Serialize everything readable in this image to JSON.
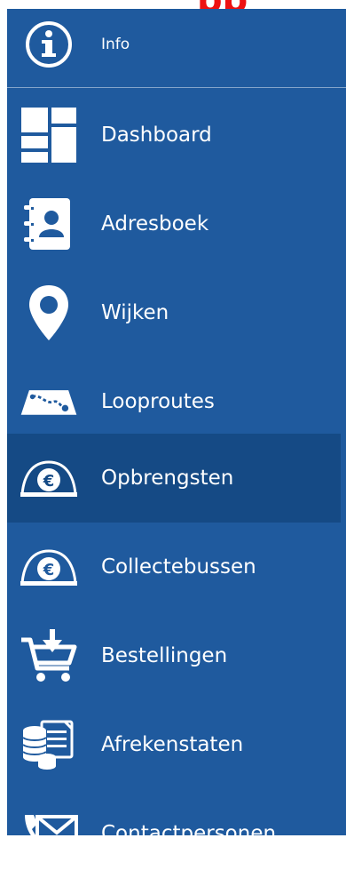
{
  "header": {
    "title_fragment": "pp"
  },
  "nav": {
    "items": [
      {
        "label": "Info",
        "icon": "info-icon"
      },
      {
        "label": "Dashboard",
        "icon": "dashboard-icon"
      },
      {
        "label": "Adresboek",
        "icon": "address-book-icon"
      },
      {
        "label": "Wijken",
        "icon": "map-pin-icon"
      },
      {
        "label": "Looproutes",
        "icon": "route-map-icon"
      },
      {
        "label": "Opbrengsten",
        "icon": "euro-coin-icon",
        "active": true
      },
      {
        "label": "Collectebussen",
        "icon": "euro-coin-icon"
      },
      {
        "label": "Bestellingen",
        "icon": "cart-download-icon"
      },
      {
        "label": "Afrekenstaten",
        "icon": "coins-document-icon"
      },
      {
        "label": "Contactpersonen",
        "icon": "phone-envelope-icon"
      }
    ]
  },
  "colors": {
    "sidebar_bg": "#1f5a9e",
    "active_bg": "#154a85",
    "text": "#ffffff",
    "title_fragment": "#ee1111"
  }
}
